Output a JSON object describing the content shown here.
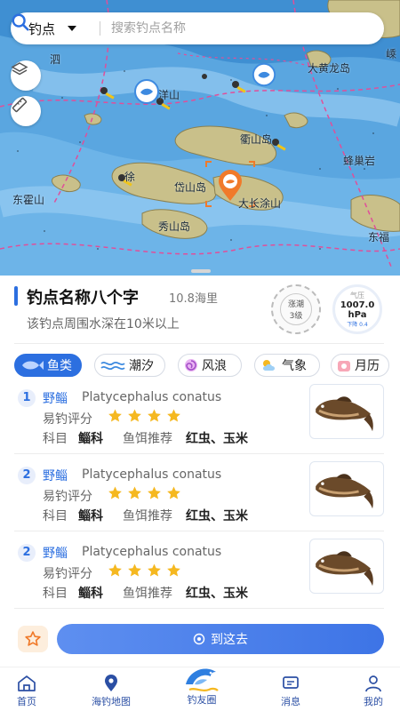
{
  "search": {
    "filter_label": "钓点",
    "placeholder": "搜索钓点名称"
  },
  "map": {
    "place_labels": [
      "大黄龙岛",
      "蜂巢岩",
      "东霍山",
      "衢山岛",
      "岱山岛",
      "大长涂山",
      "秀山岛",
      "东福",
      "洋山",
      "嵊",
      "泗",
      "徐"
    ],
    "icons": [
      "layers-icon",
      "ruler-icon",
      "fishing-spot-marker",
      "selected-spot-marker"
    ]
  },
  "spot": {
    "name": "钓点名称八个字",
    "distance": "10.8海里",
    "description": "该钓点周围水深在10米以上",
    "gauge_left_text": "涨潮",
    "gauge_left_value": "3级",
    "pressure_caption": "气压",
    "pressure_value": "1007.0",
    "pressure_unit": "hPa",
    "pressure_trend": "下降 0.4"
  },
  "tabs": [
    {
      "label": "鱼类",
      "icon": "fish-icon",
      "active": true
    },
    {
      "label": "潮汐",
      "icon": "waves-icon",
      "active": false
    },
    {
      "label": "风浪",
      "icon": "swirl-icon",
      "active": false
    },
    {
      "label": "气象",
      "icon": "weather-icon",
      "active": false
    },
    {
      "label": "月历",
      "icon": "calendar-icon",
      "active": false
    }
  ],
  "fish": [
    {
      "rank": "1",
      "name": "野鲻",
      "latin": "Platycephalus conatus",
      "rating_label": "易钓评分",
      "rating": 4,
      "family_label": "科目",
      "family": "鲻科",
      "bait_label": "鱼饵推荐",
      "bait": "红虫、玉米"
    },
    {
      "rank": "2",
      "name": "野鲻",
      "latin": "Platycephalus conatus",
      "rating_label": "易钓评分",
      "rating": 4,
      "family_label": "科目",
      "family": "鲻科",
      "bait_label": "鱼饵推荐",
      "bait": "红虫、玉米"
    },
    {
      "rank": "2",
      "name": "野鲻",
      "latin": "Platycephalus conatus",
      "rating_label": "易钓评分",
      "rating": 4,
      "family_label": "科目",
      "family": "鲻科",
      "bait_label": "鱼饵推荐",
      "bait": "红虫、玉米"
    }
  ],
  "actions": {
    "go_label": "到这去"
  },
  "tabbar": {
    "home": "首页",
    "map": "海钓地图",
    "community": "钓友圈",
    "messages": "消息",
    "mine": "我的"
  },
  "colors": {
    "accent": "#2c6fe0",
    "sea": "#3f8fd2",
    "land": "#c9c08a",
    "star": "#f5b820",
    "marker": "#f07a2a"
  }
}
